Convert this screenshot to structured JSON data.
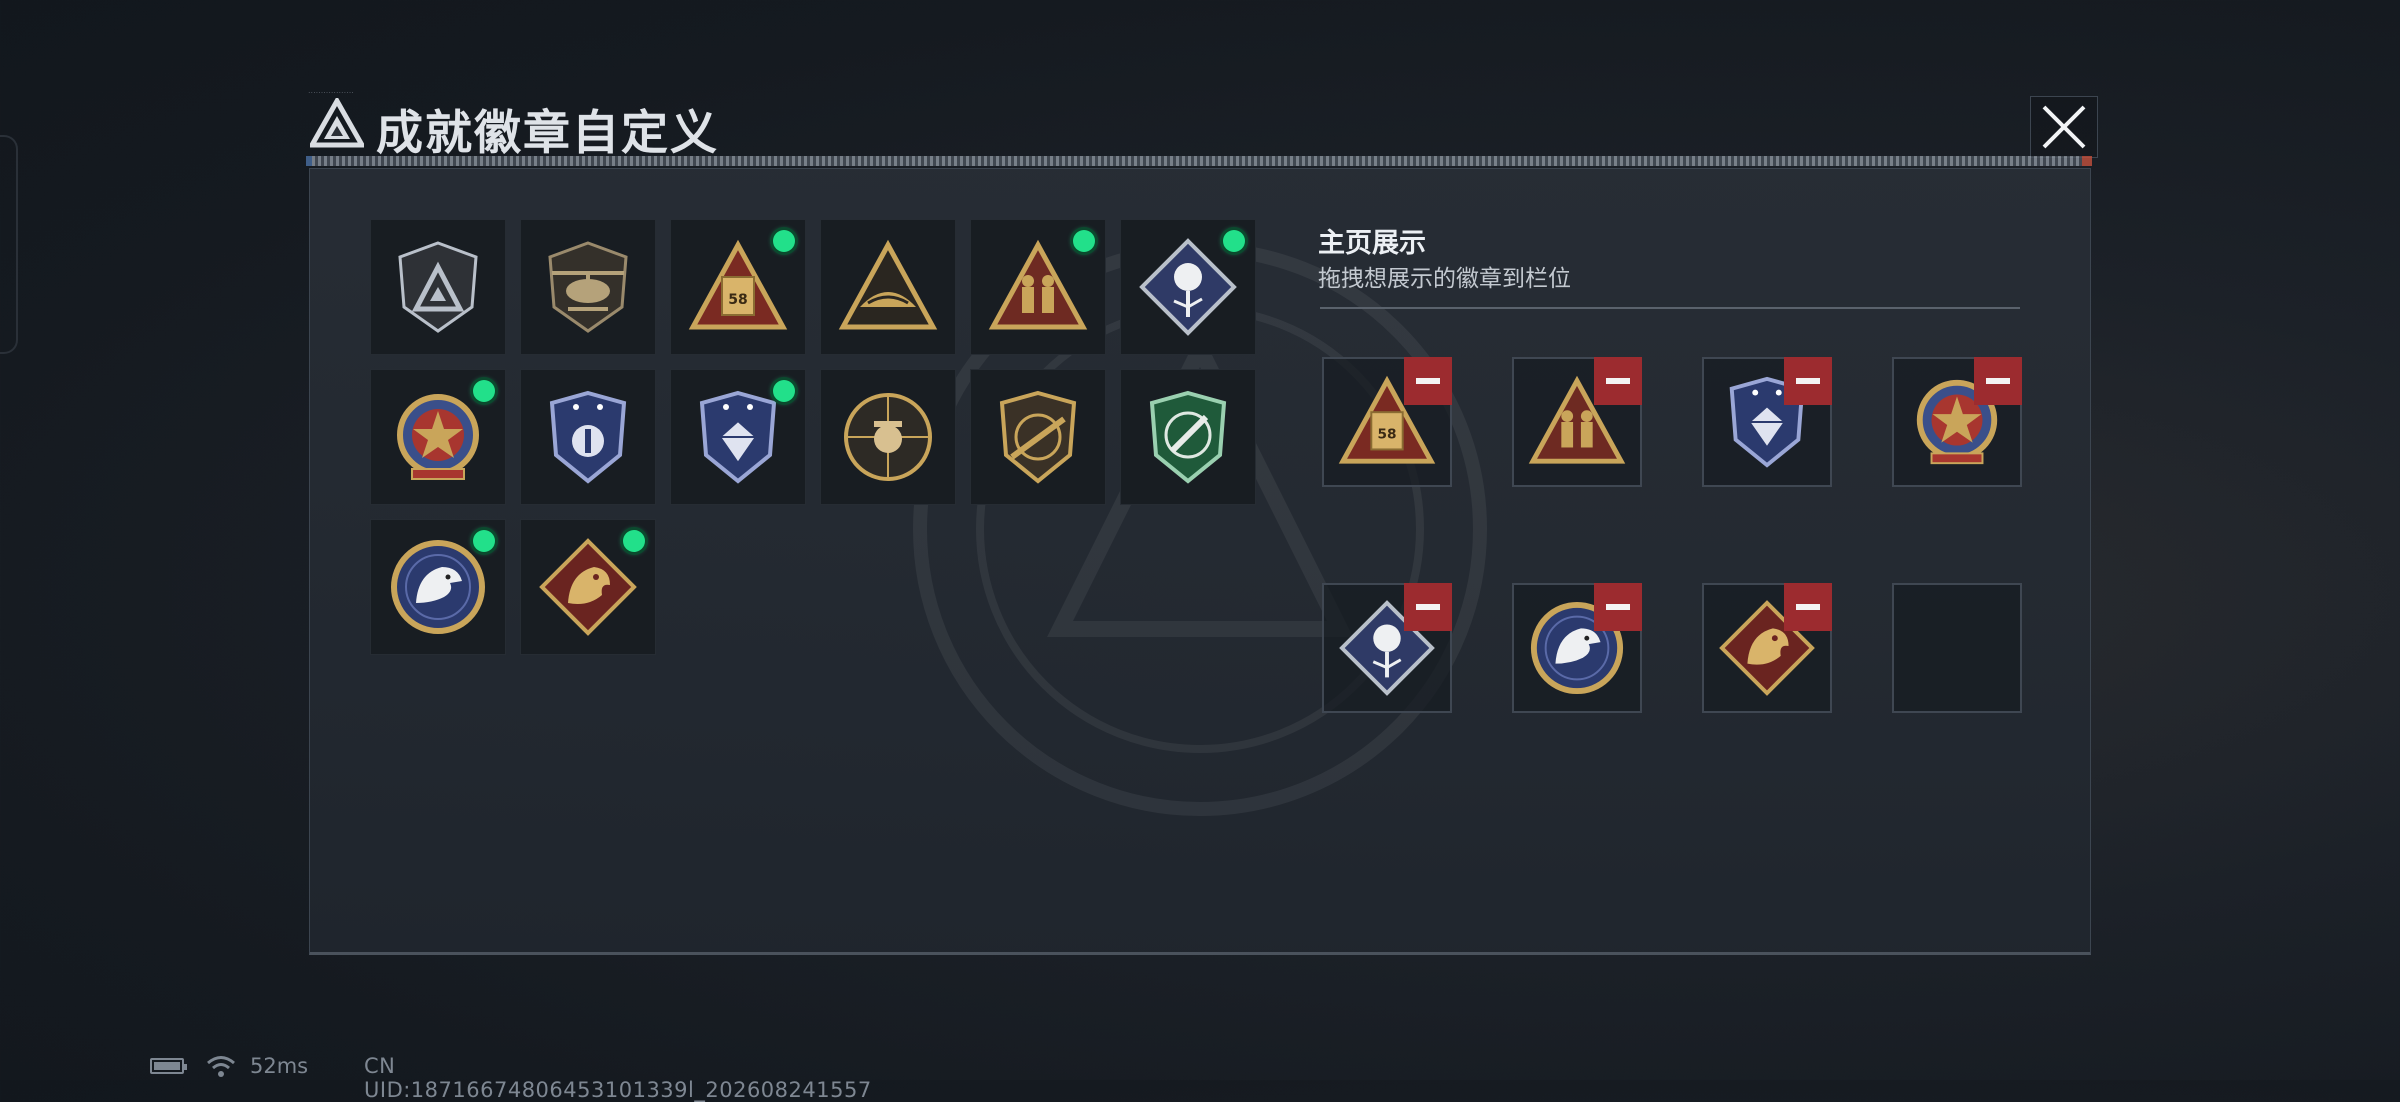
{
  "header": {
    "title": "成就徽章自定义",
    "tiny_text": "..................",
    "close_icon": "close-icon"
  },
  "colors": {
    "accent_green": "#22e08a",
    "remove_red": "#9c2b2f",
    "gold": "#c9a55a",
    "navy": "#2b3a6e"
  },
  "badges": [
    {
      "name": "silver-triangle-shield-badge",
      "icon": "shield-triangle-icon",
      "equipped": false
    },
    {
      "name": "helicopter-shield-badge",
      "icon": "helicopter-icon",
      "equipped": false
    },
    {
      "name": "supply-crate-58-badge",
      "icon": "crate-triangle-icon",
      "label": "58",
      "equipped": true
    },
    {
      "name": "gold-dune-triangle-badge",
      "icon": "dune-triangle-icon",
      "equipped": false
    },
    {
      "name": "soldiers-triangle-badge",
      "icon": "soldiers-triangle-icon",
      "equipped": true
    },
    {
      "name": "white-rose-diamond-badge",
      "icon": "rose-diamond-icon",
      "equipped": true
    },
    {
      "name": "red-star-medal-badge",
      "icon": "star-medal-icon",
      "equipped": true
    },
    {
      "name": "blue-police-shield-badge",
      "icon": "blue-shield-icon",
      "equipped": false
    },
    {
      "name": "blue-gem-shield-badge",
      "icon": "gem-shield-icon",
      "equipped": true
    },
    {
      "name": "gasmask-crosshair-badge",
      "icon": "gasmask-icon",
      "equipped": false
    },
    {
      "name": "rifle-shield-badge",
      "icon": "rifle-shield-icon",
      "equipped": false
    },
    {
      "name": "green-knife-shield-badge",
      "icon": "knife-shield-icon",
      "equipped": false
    },
    {
      "name": "eagle-round-badge",
      "icon": "eagle-icon",
      "equipped": true
    },
    {
      "name": "red-dragon-diamond-badge",
      "icon": "dragon-diamond-icon",
      "equipped": true
    }
  ],
  "display": {
    "title": "主页展示",
    "hint": "拖拽想展示的徽章到栏位",
    "slots": [
      {
        "badge": "supply-crate-58-badge",
        "filled": true
      },
      {
        "badge": "soldiers-triangle-badge",
        "filled": true
      },
      {
        "badge": "blue-gem-shield-badge",
        "filled": true
      },
      {
        "badge": "red-star-medal-badge",
        "filled": true
      },
      {
        "badge": "white-rose-diamond-badge",
        "filled": true
      },
      {
        "badge": "eagle-round-badge",
        "filled": true
      },
      {
        "badge": "red-dragon-diamond-badge",
        "filled": true
      },
      {
        "badge": "",
        "filled": false
      }
    ]
  },
  "footer": {
    "battery_icon": "battery-icon",
    "wifi_icon": "wifi-icon",
    "ping": "52ms",
    "uid": "CN UID:18716674806453101339l_202608241557"
  }
}
